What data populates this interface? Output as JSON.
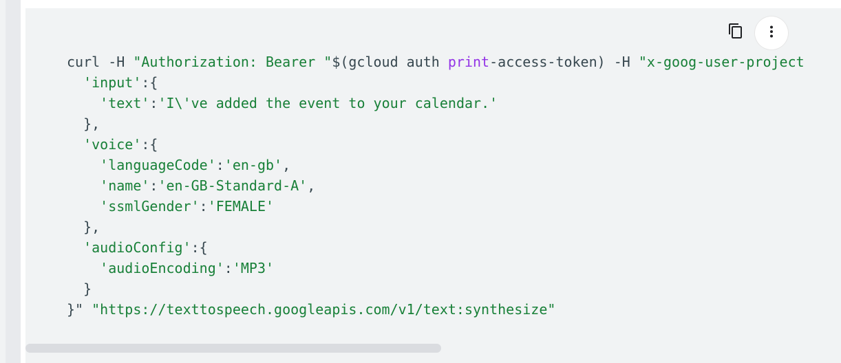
{
  "actions": {
    "copy_icon": "copy-icon",
    "more_icon": "more-vert-icon"
  },
  "code": {
    "lines": [
      [
        {
          "t": "curl -H ",
          "c": "plain"
        },
        {
          "t": "\"Authorization: Bearer \"",
          "c": "str"
        },
        {
          "t": "$(gcloud auth ",
          "c": "plain"
        },
        {
          "t": "print",
          "c": "kw"
        },
        {
          "t": "-access-token) -H ",
          "c": "plain"
        },
        {
          "t": "\"x-goog-user-project",
          "c": "str"
        }
      ],
      [
        {
          "t": "  ",
          "c": "plain"
        },
        {
          "t": "'input'",
          "c": "str"
        },
        {
          "t": ":{",
          "c": "plain"
        }
      ],
      [
        {
          "t": "    ",
          "c": "plain"
        },
        {
          "t": "'text'",
          "c": "str"
        },
        {
          "t": ":",
          "c": "plain"
        },
        {
          "t": "'I\\'ve added the event to your calendar.'",
          "c": "str"
        }
      ],
      [
        {
          "t": "  },",
          "c": "plain"
        }
      ],
      [
        {
          "t": "  ",
          "c": "plain"
        },
        {
          "t": "'voice'",
          "c": "str"
        },
        {
          "t": ":{",
          "c": "plain"
        }
      ],
      [
        {
          "t": "    ",
          "c": "plain"
        },
        {
          "t": "'languageCode'",
          "c": "str"
        },
        {
          "t": ":",
          "c": "plain"
        },
        {
          "t": "'en-gb'",
          "c": "str"
        },
        {
          "t": ",",
          "c": "plain"
        }
      ],
      [
        {
          "t": "    ",
          "c": "plain"
        },
        {
          "t": "'name'",
          "c": "str"
        },
        {
          "t": ":",
          "c": "plain"
        },
        {
          "t": "'en-GB-Standard-A'",
          "c": "str"
        },
        {
          "t": ",",
          "c": "plain"
        }
      ],
      [
        {
          "t": "    ",
          "c": "plain"
        },
        {
          "t": "'ssmlGender'",
          "c": "str"
        },
        {
          "t": ":",
          "c": "plain"
        },
        {
          "t": "'FEMALE'",
          "c": "str"
        }
      ],
      [
        {
          "t": "  },",
          "c": "plain"
        }
      ],
      [
        {
          "t": "  ",
          "c": "plain"
        },
        {
          "t": "'audioConfig'",
          "c": "str"
        },
        {
          "t": ":{",
          "c": "plain"
        }
      ],
      [
        {
          "t": "    ",
          "c": "plain"
        },
        {
          "t": "'audioEncoding'",
          "c": "str"
        },
        {
          "t": ":",
          "c": "plain"
        },
        {
          "t": "'MP3'",
          "c": "str"
        }
      ],
      [
        {
          "t": "  }",
          "c": "plain"
        }
      ],
      [
        {
          "t": "}\" ",
          "c": "plain"
        },
        {
          "t": "\"https://texttospeech.googleapis.com/v1/text:synthesize\"",
          "c": "str"
        }
      ]
    ]
  },
  "colors": {
    "plain": "#37474f",
    "string": "#188038",
    "keyword": "#9334e6",
    "panel_background": "#f1f3f4"
  },
  "scroll": {
    "horizontal_visible_fraction": 0.51
  }
}
